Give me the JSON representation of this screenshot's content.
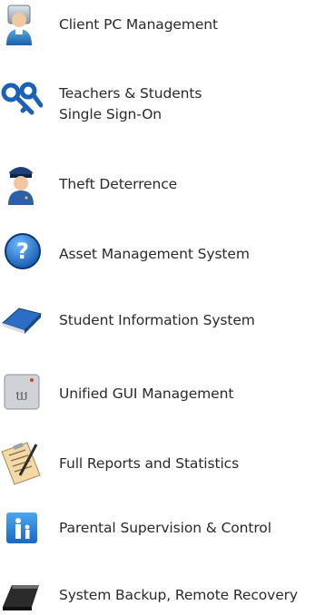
{
  "features": [
    {
      "icon": "client-pc-user-icon",
      "label": "Client PC Management"
    },
    {
      "icon": "keys-icon",
      "label": "Teachers & Students",
      "label2": "Single Sign-On"
    },
    {
      "icon": "police-officer-icon",
      "label": "Theft Deterrence"
    },
    {
      "icon": "question-help-icon",
      "label": "Asset Management System"
    },
    {
      "icon": "book-icon",
      "label": "Student Information System"
    },
    {
      "icon": "gui-window-icon",
      "label": "Unified GUI Management"
    },
    {
      "icon": "clipboard-report-icon",
      "label": "Full Reports and Statistics"
    },
    {
      "icon": "parent-child-icon",
      "label": "Parental Supervision & Control"
    },
    {
      "icon": "backup-drive-icon",
      "label": "System Backup,  Remote Recovery"
    }
  ]
}
